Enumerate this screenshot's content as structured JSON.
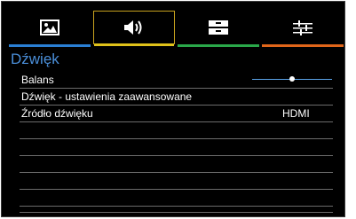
{
  "tabs": [
    {
      "icon": "picture-icon",
      "underline_color": "#2a7fd4",
      "selected": false
    },
    {
      "icon": "speaker-icon",
      "underline_color": "#e0c21a",
      "selected": true
    },
    {
      "icon": "settings-icon",
      "underline_color": "#2aa84a",
      "selected": false
    },
    {
      "icon": "equalizer-icon",
      "underline_color": "#e0661a",
      "selected": false
    }
  ],
  "menu": {
    "title": "Dźwięk",
    "items": [
      {
        "label": "Balans",
        "value": ""
      },
      {
        "label": "Dźwięk - ustawienia zaawansowane",
        "value": ""
      },
      {
        "label": "Źródło dźwięku",
        "value": "HDMI"
      },
      {
        "label": "",
        "value": ""
      },
      {
        "label": "",
        "value": ""
      },
      {
        "label": "",
        "value": ""
      },
      {
        "label": "",
        "value": ""
      },
      {
        "label": "",
        "value": ""
      },
      {
        "label": "",
        "value": ""
      }
    ],
    "balance_level": 0.5
  }
}
